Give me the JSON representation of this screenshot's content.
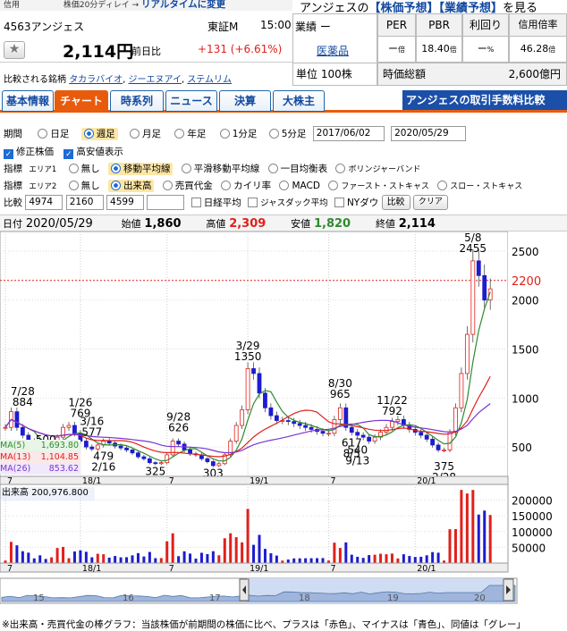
{
  "header": {
    "top_left": "信用",
    "ticker_code": "4563",
    "company": "アンジェス",
    "delay_note": "株価20分ディレイ → ",
    "realtime_link": "リアルタイムに変更",
    "title_name": "アンジェスの",
    "forecast_link": "【株価予想】",
    "earnings_link": "【業績予想】",
    "see_text": "を見る",
    "exchange": "東証M",
    "time": "15:00",
    "price": "2,114円",
    "prev_label": "前日比",
    "change": "+131",
    "change_pct": "(+6.61%)",
    "related_label": "比較される銘柄",
    "related": [
      "タカラバイオ",
      "ジーエヌアイ",
      "ステムリム"
    ],
    "perf_label": "業績",
    "perf_value": "ー",
    "sector": "医薬品",
    "unit_label": "単位",
    "unit_value": "100株"
  },
  "metrics": {
    "per_label": "PER",
    "per": "ー",
    "per_unit": "倍",
    "pbr_label": "PBR",
    "pbr": "18.40",
    "pbr_unit": "倍",
    "yield_label": "利回り",
    "yield": "ー",
    "yield_unit": "%",
    "margin_label": "信用倍率",
    "margin": "46.28",
    "margin_unit": "倍",
    "mktcap_label": "時価総額",
    "mktcap": "2,600億円"
  },
  "tabs": [
    "基本情報",
    "チャート",
    "時系列",
    "ニュース",
    "決算",
    "大株主"
  ],
  "fee_banner": "アンジェスの取引手数料比較",
  "controls": {
    "period_label": "期間",
    "periods": [
      "日足",
      "週足",
      "月足",
      "年足",
      "1分足",
      "5分足"
    ],
    "date_from": "2017/06/02",
    "date_to": "2020/05/29",
    "adjusted": "修正株価",
    "highlow": "高安値表示",
    "ind1_label": "指標",
    "area1": "エリア1",
    "area1_opts": [
      "無し",
      "移動平均線",
      "平滑移動平均線",
      "一目均衡表",
      "ボリンジャーバンド"
    ],
    "ind2_label": "指標",
    "area2": "エリア2",
    "area2_opts": [
      "無し",
      "出来高",
      "売買代金",
      "カイリ率",
      "MACD",
      "ファースト・ストキャス",
      "スロー・ストキャス"
    ],
    "compare_label": "比較",
    "compare_codes": [
      "4974",
      "2160",
      "4599",
      ""
    ],
    "nikkei": "日経平均",
    "jasdaq": "ジャスダック平均",
    "nydow": "NYダウ",
    "cmp_btn": "比較",
    "clear_btn": "クリア"
  },
  "chart_info": {
    "date_label": "日付",
    "date": "2020/05/29",
    "open_label": "始値",
    "open": "1,860",
    "high_label": "高値",
    "high": "2,309",
    "low_label": "安値",
    "low": "1,820",
    "close_label": "終値",
    "close": "2,114"
  },
  "ma": {
    "ma5_label": "MA(5)",
    "ma5": "1,693.80",
    "ma13_label": "MA(13)",
    "ma13": "1,104.85",
    "ma26_label": "MA(26)",
    "ma26": "853.62"
  },
  "volume": {
    "label": "出来高",
    "value": "200,976.800"
  },
  "footnote": "※出来高・売買代金の棒グラフ：当該株価が前期間の株価に比べ、プラスは「赤色」、マイナスは「青色」、同値は「グレー」",
  "colors": {
    "up": "#e0201b",
    "down": "#1d1ccf",
    "ma5": "#2e8b2e",
    "ma13": "#e0201b",
    "ma26": "#7a34d6",
    "current": "#e0201b"
  },
  "chart_data": {
    "type": "line",
    "x_ticks": [
      "7",
      "18/1",
      "7",
      "19/1",
      "7",
      "20/1"
    ],
    "ylim": [
      200,
      2700
    ],
    "y_ticks": [
      500,
      1000,
      1500,
      2000,
      2500
    ],
    "current_price": 2200,
    "series": [
      {
        "name": "close",
        "values": [
          700,
          860,
          700,
          620,
          560,
          545,
          510,
          500,
          520,
          600,
          700,
          720,
          640,
          560,
          500,
          480,
          520,
          560,
          540,
          510,
          490,
          470,
          440,
          400,
          380,
          340,
          330,
          340,
          420,
          560,
          530,
          470,
          430,
          420,
          380,
          350,
          310,
          330,
          420,
          560,
          720,
          880,
          1300,
          1250,
          1050,
          900,
          820,
          770,
          770,
          760,
          740,
          720,
          700,
          680,
          660,
          640,
          640,
          780,
          900,
          700,
          650,
          620,
          600,
          560,
          600,
          650,
          700,
          760,
          780,
          720,
          680,
          650,
          620,
          580,
          520,
          470,
          470,
          650,
          900,
          1250,
          1650,
          2400,
          2250,
          2000,
          2114
        ]
      }
    ],
    "annotations": [
      {
        "date": "7/28",
        "value": 884
      },
      {
        "date": "",
        "value": 500
      },
      {
        "date": "",
        "value": 424
      },
      {
        "date": "1/26",
        "value": 769
      },
      {
        "date": "3/16",
        "value": 577
      },
      {
        "date": "2/16",
        "value": 479
      },
      {
        "date": "9/28",
        "value": 626
      },
      {
        "date": "8/17",
        "value": 325
      },
      {
        "date": "12/28",
        "value": 303
      },
      {
        "date": "3/29",
        "value": 1350
      },
      {
        "date": "8/30",
        "value": 965
      },
      {
        "date": "8/5",
        "value": 617
      },
      {
        "date": "9/13",
        "value": 540
      },
      {
        "date": "11/22",
        "value": 792
      },
      {
        "date": "2/28",
        "value": 375
      },
      {
        "date": "5/8",
        "value": 2455
      }
    ],
    "volume_ylim": [
      0,
      250000
    ],
    "volume_ticks": [
      50000,
      100000,
      150000,
      200000
    ],
    "range_labels": [
      "15",
      "16",
      "17",
      "18",
      "19",
      "20"
    ]
  }
}
